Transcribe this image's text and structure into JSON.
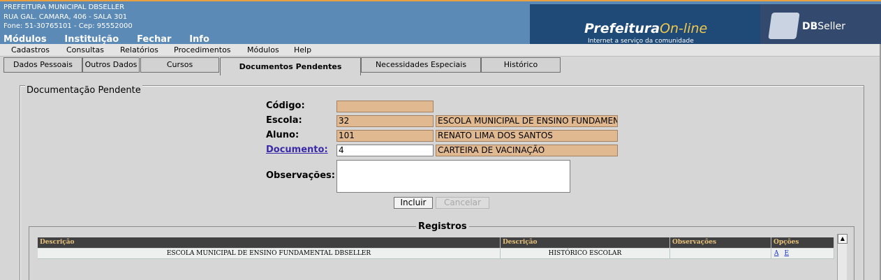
{
  "org": {
    "name": "PREFEITURA MUNICIPAL DBSELLER",
    "address": "RUA GAL. CAMARA, 406 - SALA 301",
    "phone": "Fone: 51-30765101  -  Cep: 95552000"
  },
  "topnav": [
    "Módulos",
    "Instituição",
    "Fechar",
    "Info"
  ],
  "brand": {
    "prefeitura": "Prefeitura",
    "online": "On-line",
    "tagline": "Internet a serviço da comunidade",
    "dbseller_db": "DB",
    "dbseller_seller": "Seller"
  },
  "menu": [
    "Cadastros",
    "Consultas",
    "Relatórios",
    "Procedimentos",
    "Módulos",
    "Help"
  ],
  "tabs": [
    "Dados Pessoais",
    "Outros Dados",
    "Cursos",
    "Documentos Pendentes",
    "Necessidades Especiais",
    "Histórico"
  ],
  "form": {
    "legend": "Documentação Pendente",
    "codigo_label": "Código:",
    "codigo_value": "",
    "escola_label": "Escola:",
    "escola_code": "32",
    "escola_name": "ESCOLA MUNICIPAL DE ENSINO FUNDAMEN",
    "aluno_label": "Aluno:",
    "aluno_code": "101",
    "aluno_name": "RENATO LIMA DOS SANTOS",
    "documento_label": "Documento:",
    "documento_code": "4",
    "documento_name": "CARTEIRA DE VACINAÇÃO",
    "obs_label": "Observações:",
    "obs_value": "",
    "incluir": "Incluir",
    "cancelar": "Cancelar"
  },
  "registros": {
    "legend": "Registros",
    "headers": [
      "Descrição",
      "Descrição",
      "Observações",
      "Opções"
    ],
    "rows": [
      {
        "escola": "ESCOLA MUNICIPAL DE ENSINO FUNDAMENTAL DBSELLER",
        "documento": "HISTÓRICO ESCOLAR",
        "obs": "",
        "opt_a": "A",
        "opt_e": "E"
      }
    ]
  },
  "scroll_up": "▲"
}
